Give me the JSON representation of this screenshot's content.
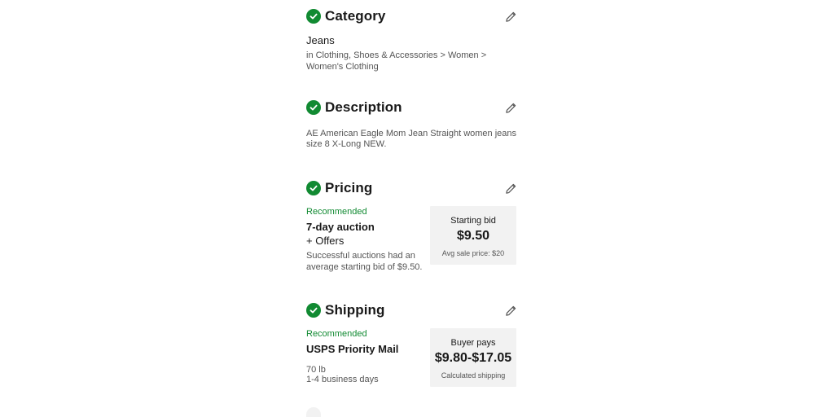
{
  "colors": {
    "accent": "#118a32",
    "text": "#191919",
    "muted": "#555555",
    "box": "#f2f2f2"
  },
  "icons": {
    "check": "check-icon",
    "edit": "pencil-icon"
  },
  "category": {
    "title": "Category",
    "value": "Jeans",
    "path_line1": "in Clothing, Shoes & Accessories > Women >",
    "path_line2": "Women's Clothing"
  },
  "description": {
    "title": "Description",
    "line1": "AE American Eagle Mom Jean Straight women jeans",
    "line2": "size 8 X-Long NEW."
  },
  "pricing": {
    "title": "Pricing",
    "recommended": "Recommended",
    "format_line1": "7-day auction",
    "format_line2": "+ Offers",
    "hint_line1": "Successful auctions had an",
    "hint_line2": "average starting bid of $9.50.",
    "box_label": "Starting bid",
    "box_price": "$9.50",
    "box_note": "Avg sale price: $20"
  },
  "shipping": {
    "title": "Shipping",
    "recommended": "Recommended",
    "service": "USPS Priority Mail",
    "weight": "70 lb",
    "days": "1-4 business days",
    "box_label": "Buyer pays",
    "box_price": "$9.80-$17.05",
    "box_note": "Calculated shipping"
  }
}
